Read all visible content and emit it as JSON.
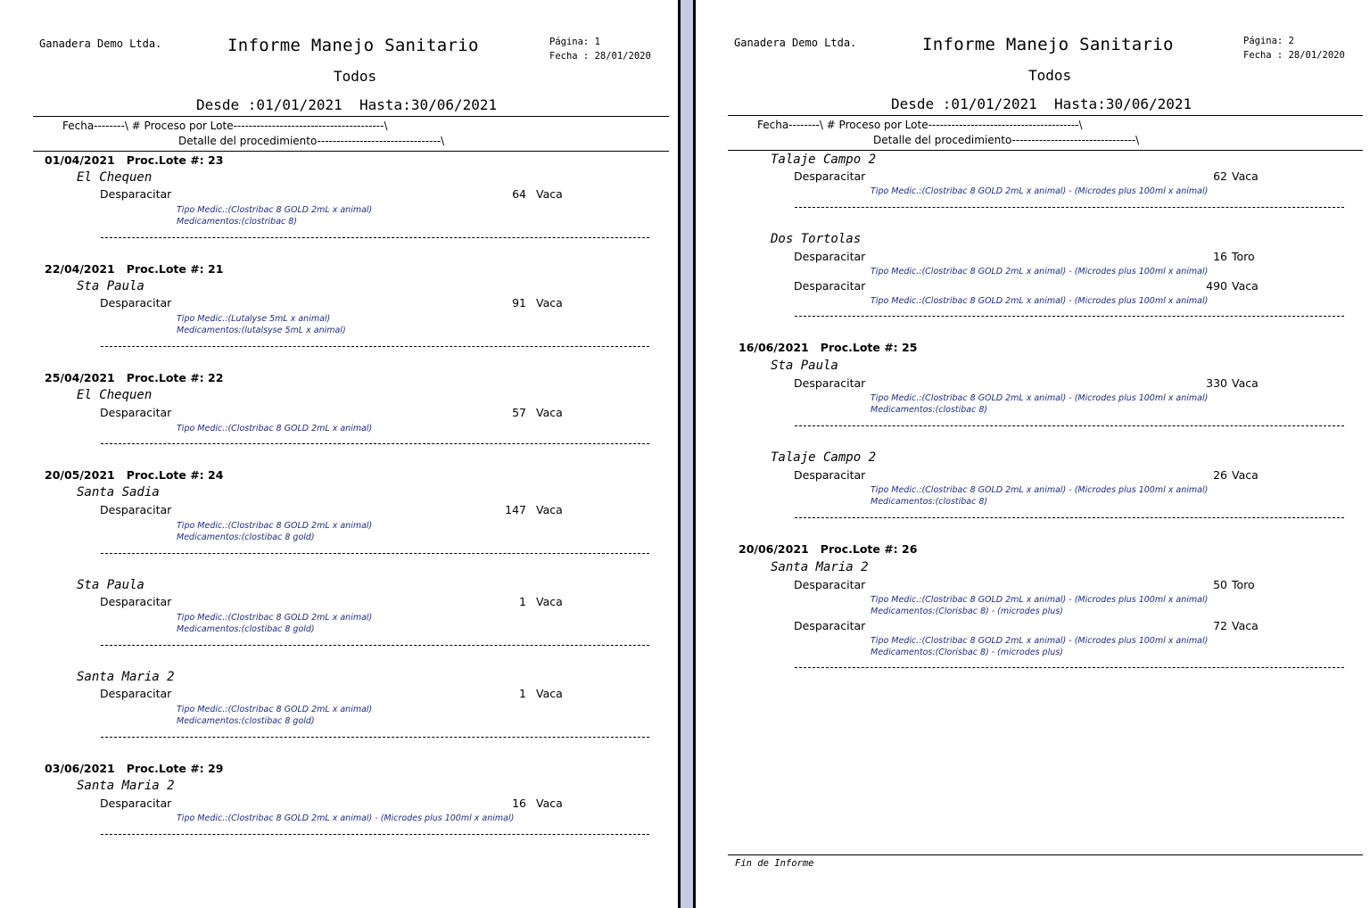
{
  "pages": [
    {
      "company": "Ganadera Demo Ltda.",
      "title": "Informe Manejo Sanitario",
      "subtitle": "Todos",
      "range": "Desde :01/01/2021  Hasta:30/06/2021",
      "page_label": "Página: 1",
      "date_label": "Fecha : 28/01/2020",
      "col_header_1": "Fecha--------\\ # Proceso por Lote---------------------------------------\\",
      "col_header_2": "Detalle del procedimiento--------------------------------\\",
      "sections": [
        {
          "date": "01/04/2021",
          "lote_label": "Proc.Lote #: 23"
        },
        {
          "date": "22/04/2021",
          "lote_label": "Proc.Lote #: 21"
        },
        {
          "date": "25/04/2021",
          "lote_label": "Proc.Lote #: 22"
        },
        {
          "date": "20/05/2021",
          "lote_label": "Proc.Lote #: 24"
        },
        {
          "date": "03/06/2021",
          "lote_label": "Proc.Lote #: 29"
        }
      ],
      "groups": [
        {
          "lote": "El Chequen",
          "items": [
            {
              "proc": "Desparacitar",
              "qty": "64",
              "unit": "Vaca",
              "tipo": "Tipo Medic.:(Clostribac 8 GOLD 2mL x animal)",
              "meds": "Medicamentos:(clostribac 8)"
            }
          ]
        },
        {
          "lote": "Sta Paula",
          "items": [
            {
              "proc": "Desparacitar",
              "qty": "91",
              "unit": "Vaca",
              "tipo": "Tipo Medic.:(Lutalyse 5mL x animal)",
              "meds": "Medicamentos:(lutalsyse 5mL x animal)"
            }
          ]
        },
        {
          "lote": "El Chequen",
          "items": [
            {
              "proc": "Desparacitar",
              "qty": "57",
              "unit": "Vaca",
              "tipo": "Tipo Medic.:(Clostribac 8 GOLD 2mL x animal)",
              "meds": ""
            }
          ]
        },
        {
          "lote": "Santa Sadia",
          "items": [
            {
              "proc": "Desparacitar",
              "qty": "147",
              "unit": "Vaca",
              "tipo": "Tipo Medic.:(Clostribac 8 GOLD 2mL x animal)",
              "meds": "Medicamentos:(clostibac 8 gold)"
            }
          ]
        },
        {
          "lote": "Sta Paula",
          "items": [
            {
              "proc": "Desparacitar",
              "qty": "1",
              "unit": "Vaca",
              "tipo": "Tipo Medic.:(Clostribac 8 GOLD 2mL x animal)",
              "meds": "Medicamentos:(clostibac 8 gold)"
            }
          ]
        },
        {
          "lote": "Santa Maria 2",
          "items": [
            {
              "proc": "Desparacitar",
              "qty": "1",
              "unit": "Vaca",
              "tipo": "Tipo Medic.:(Clostribac 8 GOLD 2mL x animal)",
              "meds": "Medicamentos:(clostibac 8 gold)"
            }
          ]
        },
        {
          "lote": "Santa Maria 2",
          "items": [
            {
              "proc": "Desparacitar",
              "qty": "16",
              "unit": "Vaca",
              "tipo": "Tipo Medic.:(Clostribac 8 GOLD 2mL x animal) - (Microdes plus 100ml x animal)",
              "meds": ""
            }
          ]
        }
      ]
    },
    {
      "company": "Ganadera Demo Ltda.",
      "title": "Informe Manejo Sanitario",
      "subtitle": "Todos",
      "range": "Desde :01/01/2021  Hasta:30/06/2021",
      "page_label": "Página: 2",
      "date_label": "Fecha : 28/01/2020",
      "col_header_1": "Fecha--------\\ # Proceso por Lote---------------------------------------\\",
      "col_header_2": "Detalle del procedimiento--------------------------------\\",
      "sections": [
        {
          "date": "16/06/2021",
          "lote_label": "Proc.Lote #: 25"
        },
        {
          "date": "20/06/2021",
          "lote_label": "Proc.Lote #: 26"
        }
      ],
      "groups": [
        {
          "lote": "Talaje Campo 2",
          "items": [
            {
              "proc": "Desparacitar",
              "qty": "62",
              "unit": "Vaca",
              "tipo": "Tipo Medic.:(Clostribac 8 GOLD 2mL x animal) - (Microdes plus 100ml x animal)",
              "meds": ""
            }
          ]
        },
        {
          "lote": "Dos Tortolas",
          "items": [
            {
              "proc": "Desparacitar",
              "qty": "16",
              "unit": "Toro",
              "tipo": "Tipo Medic.:(Clostribac 8 GOLD 2mL x animal) - (Microdes plus 100ml x animal)",
              "meds": ""
            },
            {
              "proc": "Desparacitar",
              "qty": "490",
              "unit": "Vaca",
              "tipo": "Tipo Medic.:(Clostribac 8 GOLD 2mL x animal) - (Microdes plus 100ml x animal)",
              "meds": ""
            }
          ]
        },
        {
          "lote": "Sta Paula",
          "items": [
            {
              "proc": "Desparacitar",
              "qty": "330",
              "unit": "Vaca",
              "tipo": "Tipo Medic.:(Clostribac 8 GOLD 2mL x animal) - (Microdes plus 100ml x animal)",
              "meds": "Medicamentos:(clostibac 8)"
            }
          ]
        },
        {
          "lote": "Talaje Campo 2",
          "items": [
            {
              "proc": "Desparacitar",
              "qty": "26",
              "unit": "Vaca",
              "tipo": "Tipo Medic.:(Clostribac 8 GOLD 2mL x animal) - (Microdes plus 100ml x animal)",
              "meds": "Medicamentos:(clostibac 8)"
            }
          ]
        },
        {
          "lote": "Santa Maria 2",
          "items": [
            {
              "proc": "Desparacitar",
              "qty": "50",
              "unit": "Toro",
              "tipo": "Tipo Medic.:(Clostribac 8 GOLD 2mL x animal) - (Microdes plus 100ml x animal)",
              "meds": "Medicamentos:(Clorisbac 8) - (microdes plus)"
            },
            {
              "proc": "Desparacitar",
              "qty": "72",
              "unit": "Vaca",
              "tipo": "Tipo Medic.:(Clostribac 8 GOLD 2mL x animal) - (Microdes plus 100ml x animal)",
              "meds": "Medicamentos:(Clorisbac 8) - (microdes plus)"
            }
          ]
        }
      ],
      "footer": "Fin de Informe"
    }
  ]
}
